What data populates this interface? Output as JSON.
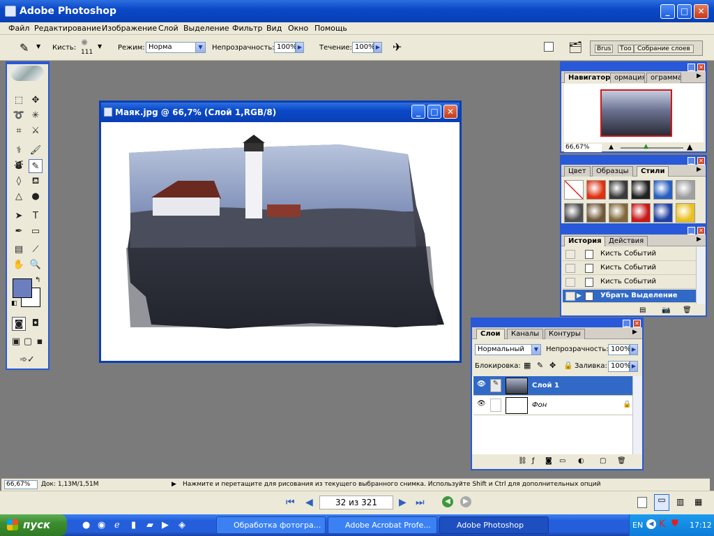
{
  "app": {
    "title": "Adobe Photoshop"
  },
  "menu": [
    "Файл",
    "Редактирование",
    "Изображение",
    "Слой",
    "Выделение",
    "Фильтр",
    "Вид",
    "Окно",
    "Помощь"
  ],
  "options": {
    "brush_label": "Кисть:",
    "brush_size": "111",
    "mode_label": "Режим:",
    "mode_value": "Норма",
    "opacity_label": "Непрозрачность:",
    "opacity_value": "100%",
    "flow_label": "Течение:",
    "flow_value": "100%",
    "well_tabs": [
      "Brus",
      "Тоо",
      "Собрание слоев"
    ]
  },
  "document": {
    "title": "Маяк.jpg @ 66,7% (Слой 1,RGB/8)"
  },
  "navigator": {
    "tabs": [
      "Навигатор",
      "ормация",
      "ограмма"
    ],
    "zoom": "66,67%"
  },
  "styles_panel": {
    "tabs": [
      "Цвет",
      "Образцы",
      "Стили"
    ],
    "swatches": [
      "#ffffff",
      "#e03010",
      "#3a3a3a",
      "#222222",
      "#2860c0",
      "#a0a0a0",
      "#505050",
      "#705838",
      "#806838",
      "#c81818",
      "#2040a0",
      "#e8c020"
    ]
  },
  "history": {
    "tabs": [
      "История",
      "Действия"
    ],
    "items": [
      "Кисть Событий",
      "Кисть Событий",
      "Кисть Событий",
      "Убрать Выделение"
    ]
  },
  "layers": {
    "tabs": [
      "Слои",
      "Каналы",
      "Контуры"
    ],
    "blend": "Нормальный",
    "opacity_label": "Непрозрачность:",
    "opacity_value": "100%",
    "lock_label": "Блокировка:",
    "fill_label": "Заливка:",
    "fill_value": "100%",
    "items": [
      "Слой 1",
      "Фон"
    ]
  },
  "status": {
    "zoom": "66,67%",
    "doc": "Док: 1,13M/1,51M",
    "hint": "Нажмите и перетащите для рисования из текущего выбранного снимка. Используйте Shift и Ctrl для дополнительных опций"
  },
  "viewer": {
    "page": "32 из 321"
  },
  "taskbar": {
    "start": "пуск",
    "tasks": [
      "Обработка фотогра...",
      "Adobe Acrobat Profe...",
      "Adobe Photoshop"
    ],
    "lang": "EN",
    "time": "17:12"
  },
  "colors": {
    "foreground": "#6b7fbf",
    "background": "#ffffff",
    "accent": "#2859d8"
  }
}
